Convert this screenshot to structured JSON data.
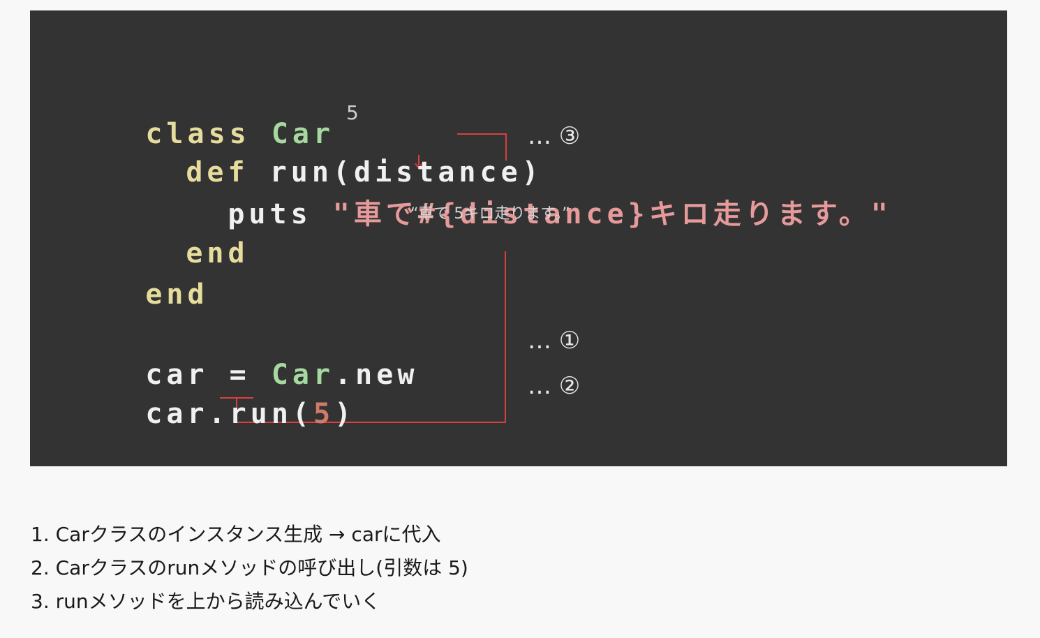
{
  "code": {
    "line1": {
      "kw": "class",
      "cls": "Car"
    },
    "line2": {
      "kw": "def",
      "rest": "run(distance)"
    },
    "line3": {
      "cmd": "puts",
      "string": "\"車で#{distance}キロ走ります。\""
    },
    "line4": {
      "kw": "end"
    },
    "line5": {
      "kw": "end"
    },
    "line6": {
      "var": "car =",
      "cls": "Car",
      "rest": ".new"
    },
    "line7": {
      "pre": "car.run(",
      "num": "5",
      "post": ")"
    }
  },
  "annotations": {
    "param_value": "5",
    "output_string": "“車で 5キロ走ります。”",
    "marker_3": "… ③",
    "marker_1": "… ①",
    "marker_2": "… ②",
    "arrow_color": "#d84040"
  },
  "notes": [
    "1. Carクラスのインスタンス生成 → carに代入",
    "2. Carクラスのrunメソッドの呼び出し(引数は 5)",
    "3. runメソッドを上から読み込んでいく"
  ]
}
